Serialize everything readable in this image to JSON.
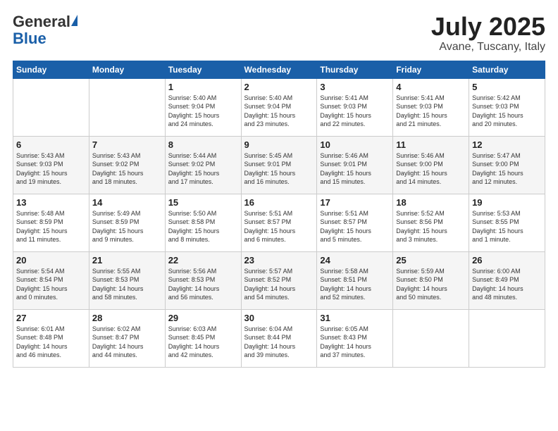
{
  "header": {
    "logo_general": "General",
    "logo_blue": "Blue",
    "month": "July 2025",
    "location": "Avane, Tuscany, Italy"
  },
  "weekdays": [
    "Sunday",
    "Monday",
    "Tuesday",
    "Wednesday",
    "Thursday",
    "Friday",
    "Saturday"
  ],
  "weeks": [
    [
      {
        "day": "",
        "info": ""
      },
      {
        "day": "",
        "info": ""
      },
      {
        "day": "1",
        "info": "Sunrise: 5:40 AM\nSunset: 9:04 PM\nDaylight: 15 hours\nand 24 minutes."
      },
      {
        "day": "2",
        "info": "Sunrise: 5:40 AM\nSunset: 9:04 PM\nDaylight: 15 hours\nand 23 minutes."
      },
      {
        "day": "3",
        "info": "Sunrise: 5:41 AM\nSunset: 9:03 PM\nDaylight: 15 hours\nand 22 minutes."
      },
      {
        "day": "4",
        "info": "Sunrise: 5:41 AM\nSunset: 9:03 PM\nDaylight: 15 hours\nand 21 minutes."
      },
      {
        "day": "5",
        "info": "Sunrise: 5:42 AM\nSunset: 9:03 PM\nDaylight: 15 hours\nand 20 minutes."
      }
    ],
    [
      {
        "day": "6",
        "info": "Sunrise: 5:43 AM\nSunset: 9:03 PM\nDaylight: 15 hours\nand 19 minutes."
      },
      {
        "day": "7",
        "info": "Sunrise: 5:43 AM\nSunset: 9:02 PM\nDaylight: 15 hours\nand 18 minutes."
      },
      {
        "day": "8",
        "info": "Sunrise: 5:44 AM\nSunset: 9:02 PM\nDaylight: 15 hours\nand 17 minutes."
      },
      {
        "day": "9",
        "info": "Sunrise: 5:45 AM\nSunset: 9:01 PM\nDaylight: 15 hours\nand 16 minutes."
      },
      {
        "day": "10",
        "info": "Sunrise: 5:46 AM\nSunset: 9:01 PM\nDaylight: 15 hours\nand 15 minutes."
      },
      {
        "day": "11",
        "info": "Sunrise: 5:46 AM\nSunset: 9:00 PM\nDaylight: 15 hours\nand 14 minutes."
      },
      {
        "day": "12",
        "info": "Sunrise: 5:47 AM\nSunset: 9:00 PM\nDaylight: 15 hours\nand 12 minutes."
      }
    ],
    [
      {
        "day": "13",
        "info": "Sunrise: 5:48 AM\nSunset: 8:59 PM\nDaylight: 15 hours\nand 11 minutes."
      },
      {
        "day": "14",
        "info": "Sunrise: 5:49 AM\nSunset: 8:59 PM\nDaylight: 15 hours\nand 9 minutes."
      },
      {
        "day": "15",
        "info": "Sunrise: 5:50 AM\nSunset: 8:58 PM\nDaylight: 15 hours\nand 8 minutes."
      },
      {
        "day": "16",
        "info": "Sunrise: 5:51 AM\nSunset: 8:57 PM\nDaylight: 15 hours\nand 6 minutes."
      },
      {
        "day": "17",
        "info": "Sunrise: 5:51 AM\nSunset: 8:57 PM\nDaylight: 15 hours\nand 5 minutes."
      },
      {
        "day": "18",
        "info": "Sunrise: 5:52 AM\nSunset: 8:56 PM\nDaylight: 15 hours\nand 3 minutes."
      },
      {
        "day": "19",
        "info": "Sunrise: 5:53 AM\nSunset: 8:55 PM\nDaylight: 15 hours\nand 1 minute."
      }
    ],
    [
      {
        "day": "20",
        "info": "Sunrise: 5:54 AM\nSunset: 8:54 PM\nDaylight: 15 hours\nand 0 minutes."
      },
      {
        "day": "21",
        "info": "Sunrise: 5:55 AM\nSunset: 8:53 PM\nDaylight: 14 hours\nand 58 minutes."
      },
      {
        "day": "22",
        "info": "Sunrise: 5:56 AM\nSunset: 8:53 PM\nDaylight: 14 hours\nand 56 minutes."
      },
      {
        "day": "23",
        "info": "Sunrise: 5:57 AM\nSunset: 8:52 PM\nDaylight: 14 hours\nand 54 minutes."
      },
      {
        "day": "24",
        "info": "Sunrise: 5:58 AM\nSunset: 8:51 PM\nDaylight: 14 hours\nand 52 minutes."
      },
      {
        "day": "25",
        "info": "Sunrise: 5:59 AM\nSunset: 8:50 PM\nDaylight: 14 hours\nand 50 minutes."
      },
      {
        "day": "26",
        "info": "Sunrise: 6:00 AM\nSunset: 8:49 PM\nDaylight: 14 hours\nand 48 minutes."
      }
    ],
    [
      {
        "day": "27",
        "info": "Sunrise: 6:01 AM\nSunset: 8:48 PM\nDaylight: 14 hours\nand 46 minutes."
      },
      {
        "day": "28",
        "info": "Sunrise: 6:02 AM\nSunset: 8:47 PM\nDaylight: 14 hours\nand 44 minutes."
      },
      {
        "day": "29",
        "info": "Sunrise: 6:03 AM\nSunset: 8:45 PM\nDaylight: 14 hours\nand 42 minutes."
      },
      {
        "day": "30",
        "info": "Sunrise: 6:04 AM\nSunset: 8:44 PM\nDaylight: 14 hours\nand 39 minutes."
      },
      {
        "day": "31",
        "info": "Sunrise: 6:05 AM\nSunset: 8:43 PM\nDaylight: 14 hours\nand 37 minutes."
      },
      {
        "day": "",
        "info": ""
      },
      {
        "day": "",
        "info": ""
      }
    ]
  ]
}
